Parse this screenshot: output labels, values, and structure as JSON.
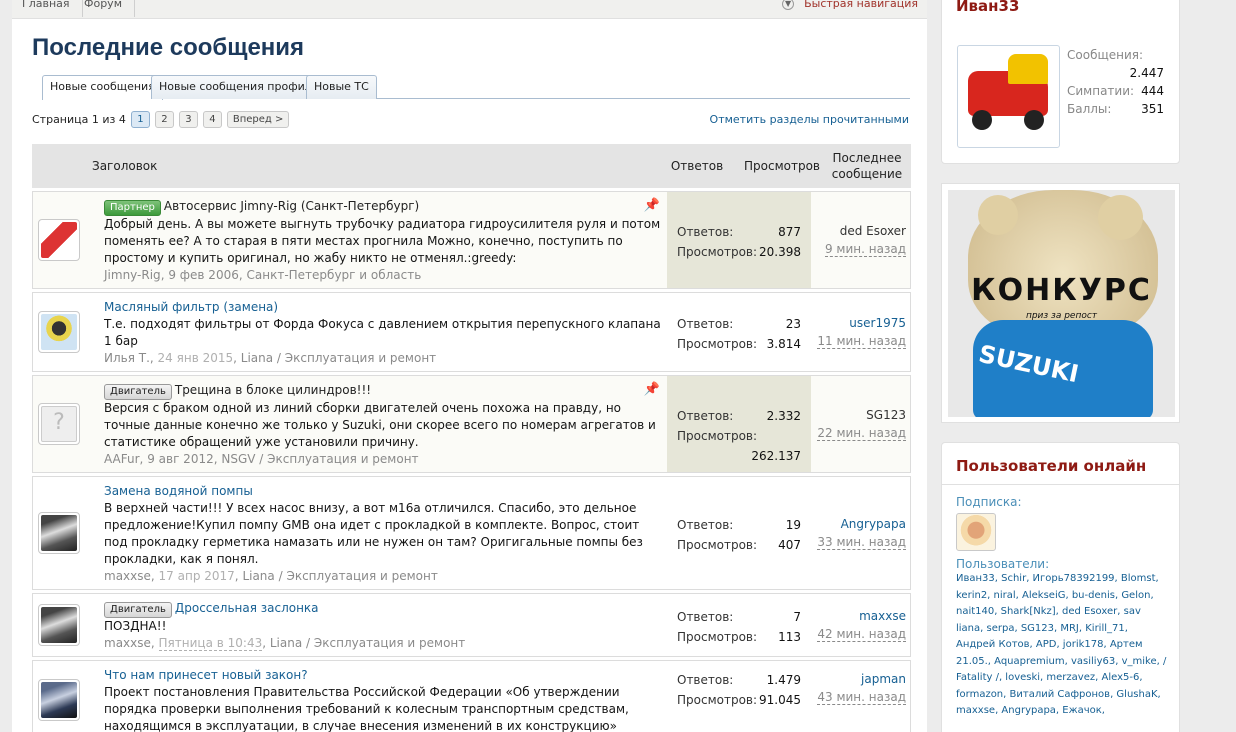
{
  "breadcrumbs": [
    "Главная",
    "Форум"
  ],
  "quick_nav": "Быстрая навигация",
  "page_title": "Последние сообщения",
  "tabs": [
    "Новые сообщения",
    "Новые сообщения профиля",
    "Новые ТС"
  ],
  "pager": {
    "label": "Страница 1 из 4",
    "pages": [
      "1",
      "2",
      "3",
      "4"
    ],
    "next": "Вперед >"
  },
  "mark_read": "Отметить разделы прочитанными",
  "table_headers": {
    "title": "Заголовок",
    "replies": "Ответов",
    "views": "Просмотров",
    "last": "Последнее сообщение"
  },
  "threads": [
    {
      "prefix": "Партнер",
      "title": "Автосервис Jimny-Rig (Санкт-Петербург)",
      "snippet": "Добрый день. А вы можете выгнуть трубочку радиатора гидроусилителя руля и потом поменять ее? А то старая в пяти местах прогнила Можно, конечно, поступить по простому и купить оригинал, но жабу никто не отменял.:greedy:",
      "author": "Jimny-Rig",
      "date": "9 фев 2006",
      "forum": "Санкт-Петербург и область",
      "category": "",
      "replies_label": "Ответов:",
      "replies": "877",
      "views_label": "Просмотров:",
      "views": "20.398",
      "last_user": "ded Esoxer",
      "last_time": "9 мин. назад"
    },
    {
      "prefix": "",
      "title": "Масляный фильтр (замена)",
      "snippet": "Т.е. подходят фильтры от Форда Фокуса с давлением открытия перепускного клапана 1 бар",
      "author": "Илья Т.",
      "date": "24 янв 2015",
      "forum": "Liana",
      "category": "Эксплуатация и ремонт",
      "replies_label": "Ответов:",
      "replies": "23",
      "views_label": "Просмотров:",
      "views": "3.814",
      "last_user": "user1975",
      "last_time": "11 мин. назад"
    },
    {
      "prefix": "Двигатель",
      "title": "Трещина в блоке цилиндров!!!",
      "snippet": "Версия с браком одной из линий сборки двигателей очень похожа на правду, но точные данные конечно же только у Suzuki, они скорее всего по номерам агрегатов и статистике обращений уже установили причину.",
      "author": "AAFur",
      "date": "9 авг 2012",
      "forum": "NSGV",
      "category": "Эксплуатация и ремонт",
      "replies_label": "Ответов:",
      "replies": "2.332",
      "views_label": "Просмотров:",
      "views": "262.137",
      "last_user": "SG123",
      "last_time": "22 мин. назад"
    },
    {
      "prefix": "",
      "title": "Замена водяной помпы",
      "snippet": "В верхней части!!! У всех насос внизу, а вот м16а отличился. Спасибо, это дельное предложение!Купил помпу GMB она идет с прокладкой в комплекте. Вопрос, стоит под прокладку герметика намазать или не нужен он там? Оригигальные помпы без прокладки, как я понял.",
      "author": "maxxse",
      "date": "17 апр 2017",
      "forum": "Liana",
      "category": "Эксплуатация и ремонт",
      "replies_label": "Ответов:",
      "replies": "19",
      "views_label": "Просмотров:",
      "views": "407",
      "last_user": "Angrypapa",
      "last_time": "33 мин. назад"
    },
    {
      "prefix": "Двигатель",
      "title": "Дроссельная заслонка",
      "snippet": "ПОЗДНА!!",
      "author": "maxxse",
      "date": "Пятница в 10:43",
      "forum": "Liana",
      "category": "Эксплуатация и ремонт",
      "replies_label": "Ответов:",
      "replies": "7",
      "views_label": "Просмотров:",
      "views": "113",
      "last_user": "maxxse",
      "last_time": "42 мин. назад"
    },
    {
      "prefix": "",
      "title": "Что нам принесет новый закон?",
      "snippet": "Проект постановления Правительства Российской Федерации «Об утверждении порядка проверки выполнения требований к колесным транспортным средствам, находящимся в эксплуатации, в случае внесения изменений в их конструкцию»",
      "author": "",
      "date": "",
      "forum": "",
      "category": "",
      "replies_label": "Ответов:",
      "replies": "1.479",
      "views_label": "Просмотров:",
      "views": "91.045",
      "last_user": "japman",
      "last_time": "43 мин. назад"
    }
  ],
  "profile": {
    "name": "Иван33",
    "messages_label": "Сообщения:",
    "messages": "2.447",
    "likes_label": "Симпатии:",
    "likes": "444",
    "points_label": "Баллы:",
    "points": "351"
  },
  "banner": {
    "text": "КОНКУРС",
    "subtext": "приз за репост",
    "brand": "SUZUKI"
  },
  "online": {
    "title": "Пользователи онлайн",
    "subscription_label": "Подписка:",
    "users_label": "Пользователи:",
    "users": "Иван33, Schir, Игорь78392199, Blomst, kerin2, niral, AlekseiG, bu-denis, Gelon, nait140, Shark[Nkz], ded Esoxer, sav liana, serpa, SG123, MRJ, Kirill_71, Андрей Котов, APD, jorik178, Артем 21.05., Aquapremium, vasiliy63, v_mike, / Fatality /, loveski, merzavez, Alex5-6, formazon, Виталий Сафронов, GlushaK, maxxse, Angrypapa, Ежачок,"
  },
  "colors": {
    "accent": "#176093",
    "title": "#1d3a5c",
    "side_heading": "#8e1a13"
  }
}
